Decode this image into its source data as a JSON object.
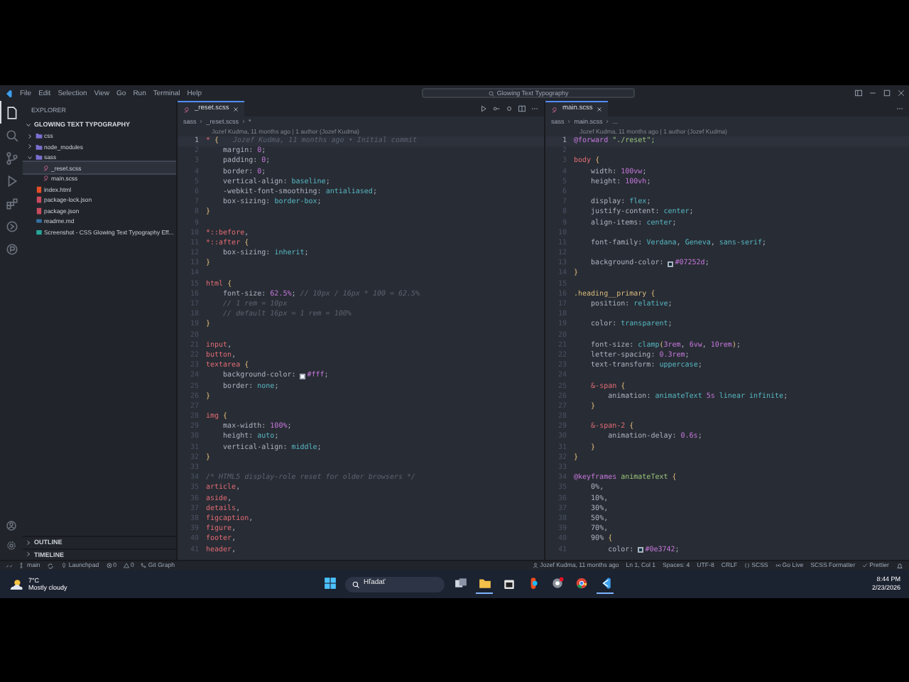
{
  "title_bar": {
    "menu": [
      "File",
      "Edit",
      "Selection",
      "View",
      "Go",
      "Run",
      "Terminal",
      "Help"
    ],
    "command_center": "Glowing Text Typography"
  },
  "activity_bar": [
    {
      "kind": "files",
      "selected": true
    },
    {
      "kind": "search",
      "selected": false
    },
    {
      "kind": "source-control",
      "selected": false
    },
    {
      "kind": "run",
      "selected": false
    },
    {
      "kind": "extensions",
      "selected": false
    },
    {
      "kind": "remote",
      "selected": false
    },
    {
      "kind": "share",
      "selected": false
    }
  ],
  "activity_bar_bottom": [
    {
      "kind": "account"
    },
    {
      "kind": "settings"
    }
  ],
  "sidebar": {
    "title": "EXPLORER",
    "folder": "GLOWING TEXT TYPOGRAPHY",
    "tree": [
      {
        "label": "css",
        "kind": "folder",
        "expanded": false,
        "selected": false
      },
      {
        "label": "node_modules",
        "kind": "folder",
        "expanded": false,
        "selected": false
      },
      {
        "label": "sass",
        "kind": "folder",
        "expanded": true,
        "selected": false,
        "children": [
          {
            "label": "_reset.scss",
            "kind": "scss",
            "selected": true
          },
          {
            "label": "main.scss",
            "kind": "scss",
            "selected": false
          }
        ]
      },
      {
        "label": "index.html",
        "kind": "html",
        "selected": false
      },
      {
        "label": "package-lock.json",
        "kind": "json",
        "selected": false
      },
      {
        "label": "package.json",
        "kind": "json",
        "selected": false
      },
      {
        "label": "readme.md",
        "kind": "md",
        "selected": false
      },
      {
        "label": "Screenshot - CSS Glowing Text Typography Eff...",
        "kind": "image",
        "selected": false
      }
    ],
    "panels": [
      {
        "label": "OUTLINE",
        "expanded": false
      },
      {
        "label": "TIMELINE",
        "expanded": false
      }
    ]
  },
  "editors": [
    {
      "tab": "_reset.scss",
      "breadcrumb": [
        "sass",
        "_reset.scss",
        "*"
      ],
      "blame": "Jozef Kudma, 11 months ago | 1 author (Jozef Kudma)",
      "inline_blame": "Jozef Kudma, 11 months ago • Initial commit",
      "lines": [
        {
          "number": "1",
          "text": "* {"
        },
        {
          "number": "2",
          "text": "    margin: 0;"
        },
        {
          "number": "3",
          "text": "    padding: 0;"
        },
        {
          "number": "4",
          "text": "    border: 0;"
        },
        {
          "number": "5",
          "text": "    vertical-align: baseline;"
        },
        {
          "number": "6",
          "text": "    -webkit-font-smoothing: antialiased;"
        },
        {
          "number": "7",
          "text": "    box-sizing: border-box;"
        },
        {
          "number": "8",
          "text": "}"
        },
        {
          "number": "9"
        },
        {
          "number": "10",
          "text": "*::before,"
        },
        {
          "number": "11",
          "text": "*::after {"
        },
        {
          "number": "12",
          "text": "    box-sizing: inherit;"
        },
        {
          "number": "13",
          "text": "}"
        },
        {
          "number": "14"
        },
        {
          "number": "15",
          "text": "html {"
        },
        {
          "number": "16",
          "text": "    font-size: 62.5%; // 10px / 16px * 100 = 62.5%"
        },
        {
          "number": "17",
          "text": "    // 1 rem = 10px"
        },
        {
          "number": "18",
          "text": "    // default 16px = 1 rem = 100%"
        },
        {
          "number": "19",
          "text": "}"
        },
        {
          "number": "20"
        },
        {
          "number": "21",
          "text": "input,"
        },
        {
          "number": "22",
          "text": "button,"
        },
        {
          "number": "23",
          "text": "textarea {"
        },
        {
          "number": "24",
          "text": "    background-color: #fff;"
        },
        {
          "number": "25",
          "text": "    border: none;"
        },
        {
          "number": "26",
          "text": "}"
        },
        {
          "number": "27"
        },
        {
          "number": "28",
          "text": "img {"
        },
        {
          "number": "29",
          "text": "    max-width: 100%;"
        },
        {
          "number": "30",
          "text": "    height: auto;"
        },
        {
          "number": "31",
          "text": "    vertical-align: middle;"
        },
        {
          "number": "32",
          "text": "}"
        },
        {
          "number": "33"
        },
        {
          "number": "34",
          "text": "/* HTML5 display-role reset for older browsers */"
        },
        {
          "number": "35",
          "text": "article,"
        },
        {
          "number": "36",
          "text": "aside,"
        },
        {
          "number": "37",
          "text": "details,"
        },
        {
          "number": "38",
          "text": "figcaption,"
        },
        {
          "number": "39",
          "text": "figure,"
        },
        {
          "number": "40",
          "text": "footer,"
        },
        {
          "number": "41",
          "text": "header,"
        }
      ]
    },
    {
      "tab": "main.scss",
      "breadcrumb": [
        "sass",
        "main.scss",
        "..."
      ],
      "blame": "Jozef Kudma, 11 months ago | 1 author (Jozef Kudma)",
      "lines": [
        {
          "number": "1",
          "text": "@forward \"./reset\";"
        },
        {
          "number": "2"
        },
        {
          "number": "3",
          "text": "body {"
        },
        {
          "number": "4",
          "text": "    width: 100vw;"
        },
        {
          "number": "5",
          "text": "    height: 100vh;"
        },
        {
          "number": "6"
        },
        {
          "number": "7",
          "text": "    display: flex;"
        },
        {
          "number": "8",
          "text": "    justify-content: center;"
        },
        {
          "number": "9",
          "text": "    align-items: center;"
        },
        {
          "number": "10"
        },
        {
          "number": "11",
          "text": "    font-family: Verdana, Geneva, sans-serif;"
        },
        {
          "number": "12"
        },
        {
          "number": "13",
          "text": "    background-color: #07252d;"
        },
        {
          "number": "14",
          "text": "}"
        },
        {
          "number": "15"
        },
        {
          "number": "16",
          "text": ".heading__primary {"
        },
        {
          "number": "17",
          "text": "    position: relative;"
        },
        {
          "number": "18"
        },
        {
          "number": "19",
          "text": "    color: transparent;"
        },
        {
          "number": "20"
        },
        {
          "number": "21",
          "text": "    font-size: clamp(3rem, 6vw, 10rem);"
        },
        {
          "number": "22",
          "text": "    letter-spacing: 0.3rem;"
        },
        {
          "number": "23",
          "text": "    text-transform: uppercase;"
        },
        {
          "number": "24"
        },
        {
          "number": "25",
          "text": "    &-span {"
        },
        {
          "number": "26",
          "text": "        animation: animateText 5s linear infinite;"
        },
        {
          "number": "27",
          "text": "    }"
        },
        {
          "number": "28"
        },
        {
          "number": "29",
          "text": "    &-span-2 {"
        },
        {
          "number": "30",
          "text": "        animation-delay: 0.6s;"
        },
        {
          "number": "31",
          "text": "    }"
        },
        {
          "number": "32",
          "text": "}"
        },
        {
          "number": "33"
        },
        {
          "number": "34",
          "text": "@keyframes animateText {"
        },
        {
          "number": "35",
          "text": "    0%,"
        },
        {
          "number": "36",
          "text": "    10%,"
        },
        {
          "number": "37",
          "text": "    30%,"
        },
        {
          "number": "38",
          "text": "    50%,"
        },
        {
          "number": "39",
          "text": "    70%,"
        },
        {
          "number": "40",
          "text": "    90% {"
        },
        {
          "number": "41",
          "text": "        color: #0e3742;"
        }
      ]
    }
  ],
  "status_bar": {
    "left": [
      {
        "kind": "remote"
      },
      {
        "kind": "branch",
        "text": "main"
      },
      {
        "kind": "sync"
      },
      {
        "kind": "launchpad",
        "text": "Launchpad"
      },
      {
        "kind": "errors",
        "text": "0"
      },
      {
        "kind": "warnings",
        "text": "0"
      },
      {
        "kind": "graph",
        "text": "Git Graph"
      }
    ],
    "right": [
      {
        "kind": "blame",
        "text": "Jozef Kudma, 11 months ago"
      },
      {
        "kind": "plain",
        "text": "Ln 1, Col 1"
      },
      {
        "kind": "plain",
        "text": "Spaces: 4"
      },
      {
        "kind": "plain",
        "text": "UTF-8"
      },
      {
        "kind": "plain",
        "text": "CRLF"
      },
      {
        "kind": "language",
        "text": "SCSS"
      },
      {
        "kind": "golive",
        "text": "Go Live"
      },
      {
        "kind": "plain",
        "text": "SCSS Formatter"
      },
      {
        "kind": "check",
        "text": "Prettier"
      },
      {
        "kind": "bell"
      }
    ]
  },
  "taskbar": {
    "weather": {
      "temp": "7°C",
      "condition": "Mostly cloudy"
    },
    "search": {
      "placeholder": "Hľadať"
    },
    "apps": [
      {
        "kind": "start",
        "running": false
      },
      {
        "kind": "task-view",
        "running": false
      },
      {
        "kind": "folder",
        "running": true
      },
      {
        "kind": "store",
        "running": false
      },
      {
        "kind": "design",
        "running": false
      },
      {
        "kind": "browser-alert",
        "running": false
      },
      {
        "kind": "browser",
        "running": false
      },
      {
        "kind": "code",
        "running": true
      }
    ],
    "clock": {
      "time": "8:44 PM",
      "date": "2/23/2026"
    }
  }
}
